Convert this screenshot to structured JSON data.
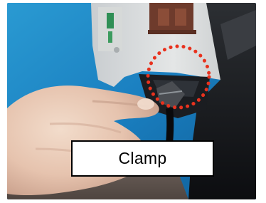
{
  "photo": {
    "subject": "hand-pointing-at-clamp-inside-device",
    "highlight_color": "#e8321e"
  },
  "callout": {
    "label": "Clamp"
  }
}
